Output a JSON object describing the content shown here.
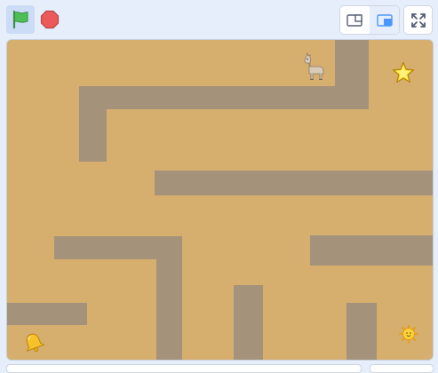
{
  "toolbar": {
    "green_flag_icon": "green-flag-icon",
    "stop_icon": "stop-sign-icon",
    "small_stage_icon": "small-stage-icon",
    "normal_stage_icon": "normal-stage-icon",
    "fullscreen_icon": "fullscreen-icon",
    "active_layout": "normal-stage"
  },
  "stage": {
    "background_color": "#d6ae6e",
    "wall_color": "#a4937a",
    "sprites": [
      "llama",
      "star",
      "bell",
      "sun"
    ]
  },
  "colors": {
    "flag_green": "#4cbf56",
    "stop_red": "#ec5959",
    "accent_blue": "#4c97ff",
    "page_bg": "#e5eefa"
  }
}
